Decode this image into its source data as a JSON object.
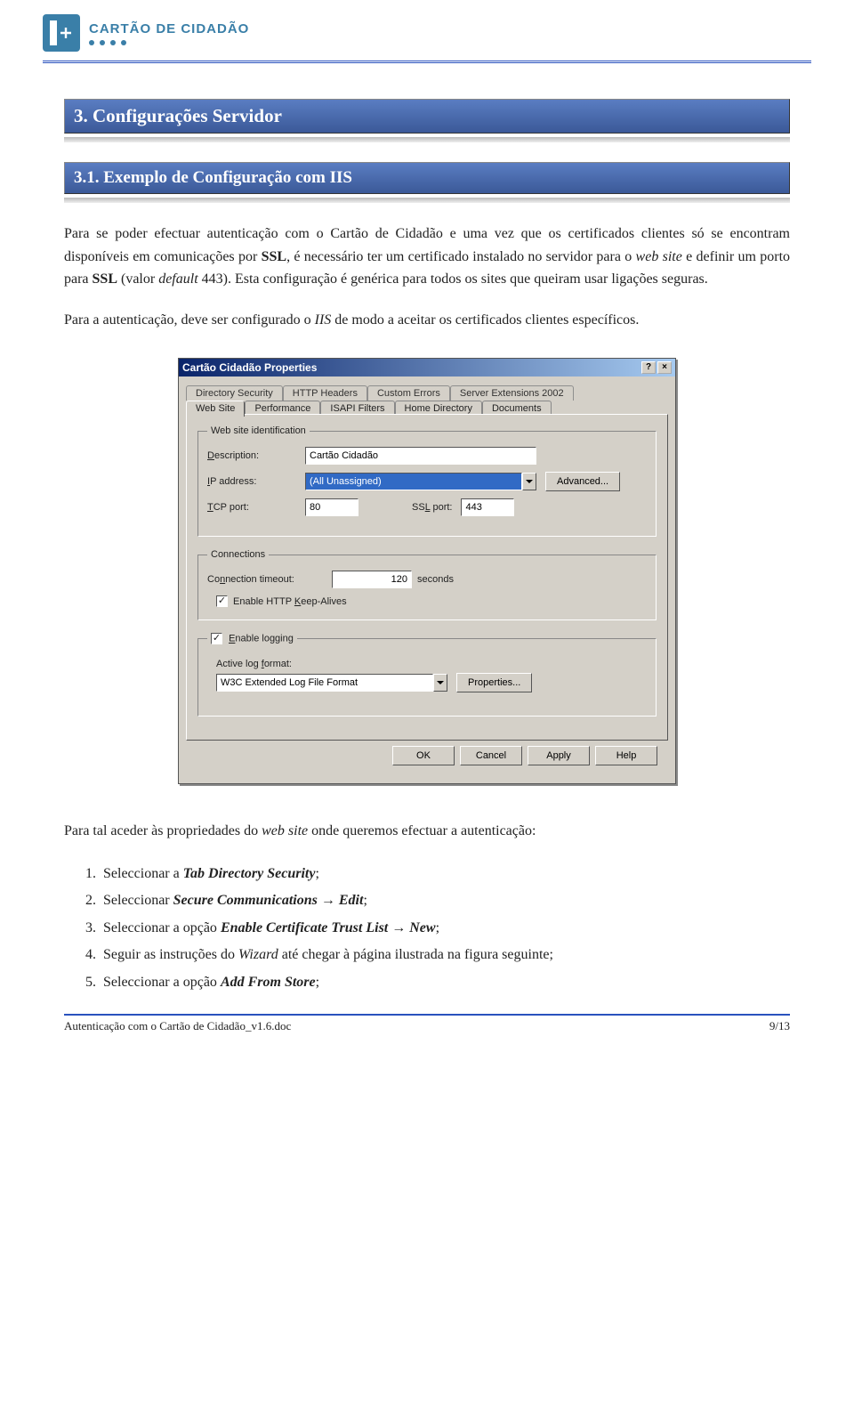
{
  "header": {
    "brand": "CARTÃO DE CIDADÃO"
  },
  "sections": {
    "h2": "3.   Configurações Servidor",
    "h3": "3.1.   Exemplo de Configuração com IIS"
  },
  "para1_parts": {
    "p1": "Para se poder efectuar autenticação com o Cartão de Cidadão e uma vez que os certificados clientes só se encontram disponíveis em comunicações por ",
    "p2_bold": "SSL",
    "p3": ", é necessário ter um certificado instalado no servidor para o ",
    "p4_ital": "web site",
    "p5": " e definir um porto para ",
    "p6_bold": "SSL",
    "p7": " (valor ",
    "p8_ital": "default",
    "p9": " 443). Esta configuração é genérica para todos os sites que queiram usar ligações seguras."
  },
  "para2_parts": {
    "p1": "Para a autenticação, deve ser configurado o ",
    "p2_ital": "IIS",
    "p3": " de modo a aceitar os certificados clientes específicos."
  },
  "dialog": {
    "title": "Cartão Cidadão Properties",
    "tabs_back": [
      "Directory Security",
      "HTTP Headers",
      "Custom Errors",
      "Server Extensions 2002"
    ],
    "tabs_front": [
      "Web Site",
      "Performance",
      "ISAPI Filters",
      "Home Directory",
      "Documents"
    ],
    "active_tab": "Web Site",
    "websiteid": {
      "legend": "Web site identification",
      "desc_label": "Description:",
      "desc_value": "Cartão Cidadão",
      "ip_label": "IP address:",
      "ip_value": "(All Unassigned)",
      "advanced": "Advanced...",
      "tcp_label": "TCP port:",
      "tcp_value": "80",
      "ssl_label": "SSL port:",
      "ssl_value": "443"
    },
    "connections": {
      "legend": "Connections",
      "timeout_label": "Connection timeout:",
      "timeout_value": "120",
      "timeout_unit": "seconds",
      "keepalive": "Enable HTTP Keep-Alives"
    },
    "logging": {
      "enable": "Enable logging",
      "format_label": "Active log format:",
      "format_value": "W3C Extended Log File Format",
      "properties": "Properties..."
    },
    "buttons": {
      "ok": "OK",
      "cancel": "Cancel",
      "apply": "Apply",
      "help": "Help"
    }
  },
  "para3_parts": {
    "p1": "Para tal aceder às propriedades do ",
    "p2_ital": "web site",
    "p3": " onde queremos efectuar a autenticação:"
  },
  "steps": [
    {
      "a": "Seleccionar a ",
      "b_bi": "Tab Directory Security",
      "c": ";"
    },
    {
      "a": "Seleccionar ",
      "b_bi": "Secure Communications",
      "arrow": " → ",
      "d_bi": "Edit",
      "c": ";"
    },
    {
      "a": "Seleccionar a opção ",
      "b_bi": "Enable Certificate Trust List",
      "arrow": " → ",
      "d_bi": "New",
      "c": ";"
    },
    {
      "a": "Seguir as instruções do ",
      "b_i": "Wizard",
      "c": " até chegar à página ilustrada na figura seguinte;"
    },
    {
      "a": "Seleccionar a opção ",
      "b_bi": "Add From Store",
      "c": ";"
    }
  ],
  "footer": {
    "docname": "Autenticação com o Cartão de Cidadão_v1.6.doc",
    "page": "9/13"
  }
}
